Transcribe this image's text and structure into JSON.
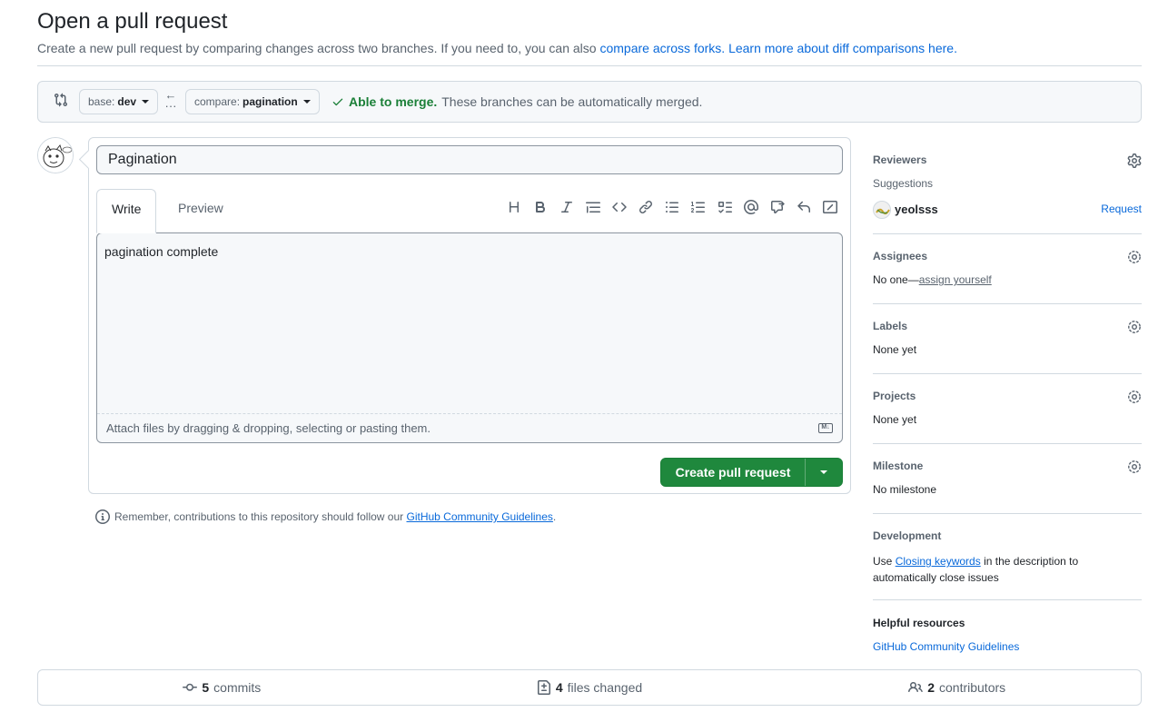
{
  "header": {
    "title": "Open a pull request",
    "subtitle_prefix": "Create a new pull request by comparing changes across two branches. If you need to, you can also",
    "compare_forks_link": "compare across forks.",
    "learn_more_link": "Learn more about diff comparisons here."
  },
  "range": {
    "base_label": "base:",
    "base_value": "dev",
    "compare_label": "compare:",
    "compare_value": "pagination",
    "merge_ok": "Able to merge.",
    "merge_text": "These branches can be automatically merged."
  },
  "form": {
    "title_value": "Pagination",
    "tab_write": "Write",
    "tab_preview": "Preview",
    "body_value": "pagination complete",
    "attach_hint": "Attach files by dragging & dropping, selecting or pasting them.",
    "create_label": "Create pull request"
  },
  "remember": {
    "text": "Remember, contributions to this repository should follow our",
    "link": "GitHub Community Guidelines",
    "period": "."
  },
  "sidebar": {
    "reviewers": {
      "title": "Reviewers",
      "suggestions": "Suggestions",
      "user": "yeolsss",
      "request": "Request"
    },
    "assignees": {
      "title": "Assignees",
      "none": "No one—",
      "assign": "assign yourself"
    },
    "labels": {
      "title": "Labels",
      "value": "None yet"
    },
    "projects": {
      "title": "Projects",
      "value": "None yet"
    },
    "milestone": {
      "title": "Milestone",
      "value": "No milestone"
    },
    "development": {
      "title": "Development",
      "use": "Use",
      "link": "Closing keywords",
      "rest": "in the description to automatically close issues"
    },
    "helpful": {
      "title": "Helpful resources",
      "link": "GitHub Community Guidelines"
    }
  },
  "stats": {
    "commits_count": "5",
    "commits_label": "commits",
    "files_count": "4",
    "files_label": "files changed",
    "contributors_count": "2",
    "contributors_label": "contributors"
  },
  "colors": {
    "primary_green": "#1f883d",
    "link_blue": "#0969da",
    "success": "#1a7f37"
  }
}
